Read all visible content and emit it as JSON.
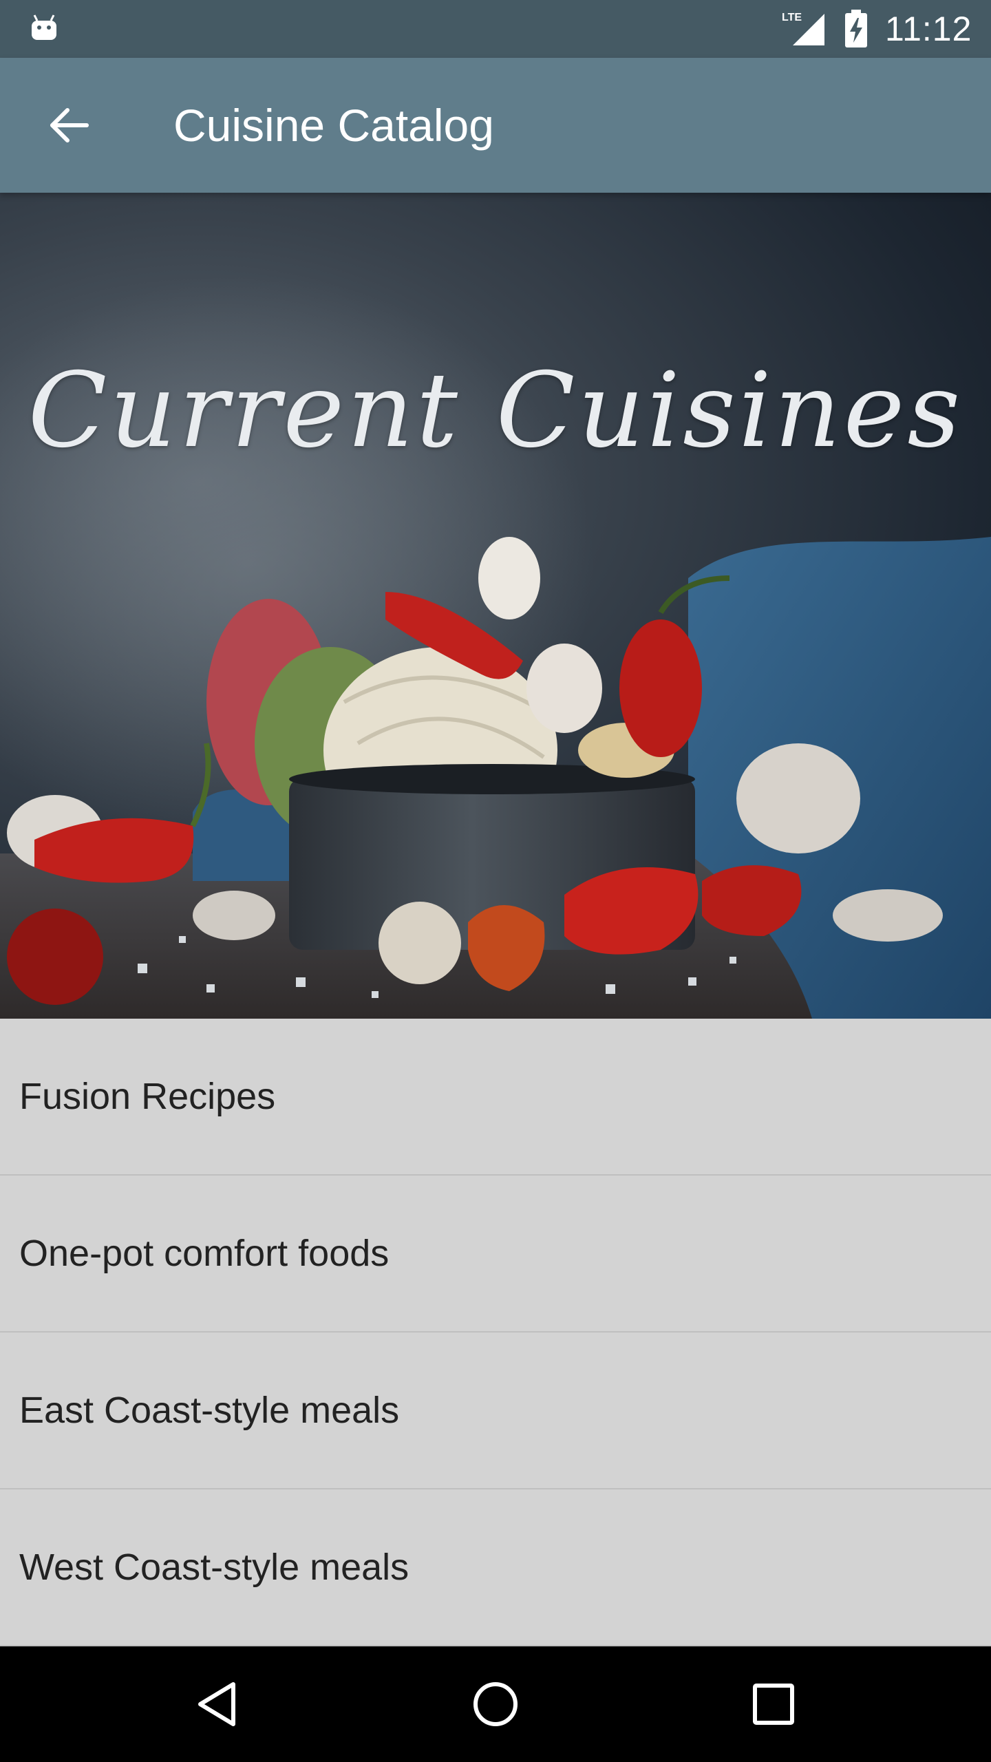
{
  "status_bar": {
    "time": "11:12",
    "icons": [
      "android-debug-icon",
      "lte-signal-icon",
      "battery-charging-icon"
    ]
  },
  "app_bar": {
    "title": "Cuisine Catalog",
    "back_icon": "arrow-back-icon"
  },
  "hero": {
    "title": "Current Cuisines",
    "image": "food-still-life-noodles-peppers-garlic"
  },
  "list": {
    "items": [
      {
        "label": "Fusion Recipes"
      },
      {
        "label": "One-pot comfort foods"
      },
      {
        "label": "East Coast-style meals"
      },
      {
        "label": "West Coast-style meals"
      }
    ]
  },
  "nav_bar": {
    "icons": [
      "back-triangle-icon",
      "home-circle-icon",
      "recents-square-icon"
    ]
  },
  "colors": {
    "status_bar": "#455a64",
    "app_bar": "#607d8b",
    "list_background": "#d3d3d3",
    "nav_bar": "#000000"
  }
}
